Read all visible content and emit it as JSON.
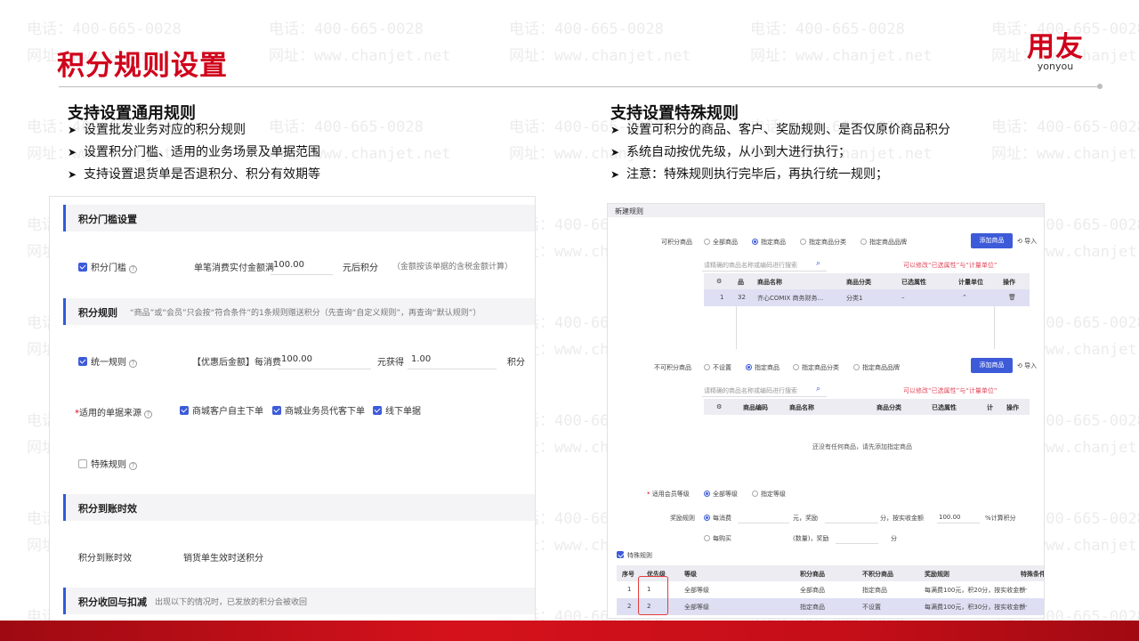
{
  "watermark": {
    "phone": "电话：400-665-0028",
    "site": "网址：www.chanjet.net"
  },
  "page_title": "积分规则设置",
  "logo": {
    "cn": "用友",
    "en": "yonyou"
  },
  "left_section": {
    "heading": "支持设置通用规则",
    "bullets": [
      "设置批发业务对应的积分规则",
      "设置积分门槛、适用的业务场景及单据范围",
      "支持设置退货单是否退积分、积分有效期等"
    ]
  },
  "right_section": {
    "heading": "支持设置特殊规则",
    "bullets": [
      "设置可积分的商品、客户、奖励规则、是否仅原价商品积分",
      "系统自动按优先级，从小到大进行执行；",
      "注意：特殊规则执行完毕后，再执行统一规则；"
    ]
  },
  "left_panel": {
    "threshold_section": "积分门槛设置",
    "threshold_check": "积分门槛",
    "threshold_label": "单笔消费实付金额满",
    "threshold_value": "100.00",
    "threshold_suffix": "元后积分",
    "threshold_hint": "（金额按该单据的含税金额计算）",
    "rule_section": "积分规则",
    "rule_note": "“商品”或“会员”只会按“符合条件”的1条规则赠送积分（先查询“自定义规则”，再查询“默认规则”）",
    "unified_check": "统一规则",
    "unified_label": "【优惠后金额】每消费",
    "unified_value": "100.00",
    "unified_mid": "元获得",
    "unified_points": "1.00",
    "unified_unit": "积分",
    "source_label": "适用的单据来源",
    "source_required": "*",
    "sources": [
      "商城客户自主下单",
      "商城业务员代客下单",
      "线下单据"
    ],
    "special_check": "特殊规则",
    "arrival_section": "积分到账时效",
    "arrival_label": "积分到账时效",
    "arrival_value": "销货单生效时送积分",
    "recover_section": "积分收回与扣减",
    "recover_note": "出现以下的情况时，已发放的积分会被收回"
  },
  "right_panel": {
    "header": "新建规则",
    "allow_label": "可积分商品",
    "allow_options": [
      "全部商品",
      "指定商品",
      "指定商品分类",
      "指定商品品牌"
    ],
    "allow_selected": 1,
    "add_button": "添加商品",
    "import_button": "导入",
    "search_placeholder": "请精确的商品名称或编码进行搜索",
    "search_hint": "可以修改“已选属性”与“计量单位”",
    "allow_table_headers": [
      "商品名称",
      "商品分类",
      "已选属性",
      "计量单位",
      "操作"
    ],
    "allow_row": {
      "index": "1",
      "code": "32",
      "name": "齐心COMIX 商务财务...",
      "category": "分类1",
      "attr": "–"
    },
    "deny_label": "不可积分商品",
    "deny_options": [
      "不设置",
      "指定商品",
      "指定商品分类",
      "指定商品品牌"
    ],
    "deny_selected": 1,
    "deny_table_headers": [
      "商品编码",
      "商品名称",
      "商品分类",
      "已选属性",
      "计",
      "操作"
    ],
    "empty_message": "还没有任何商品，请先添加指定商品",
    "member_label": "适用会员等级",
    "member_required": "*",
    "member_options": [
      "全部等级",
      "指定等级"
    ],
    "reward_label": "奖励规则",
    "reward_opt1": "每消费",
    "reward_text1a": "元，奖励",
    "reward_text1b": "分，按实收金额",
    "reward_value": "100.00",
    "reward_text1c": "%计算积分",
    "reward_opt2": "每购买",
    "reward_text2a": "(数量)，奖励",
    "reward_text2b": "分",
    "special_check": "特殊规则",
    "table_headers": [
      "序号",
      "优先级",
      "等级",
      "积分商品",
      "不积分商品",
      "奖励规则",
      "特殊条件"
    ],
    "table_rows": [
      [
        "1",
        "1",
        "全部等级",
        "全部商品",
        "指定商品",
        "每满费100元，积20分，按实收金额",
        "---"
      ],
      [
        "2",
        "2",
        "全部等级",
        "指定商品",
        "不设置",
        "每满费100元，积30分，按实收金额",
        "---"
      ]
    ]
  },
  "colors": {
    "brand_red": "#d0021b",
    "accent_blue": "#3d5bd9",
    "highlight_red": "#e23b3b"
  }
}
